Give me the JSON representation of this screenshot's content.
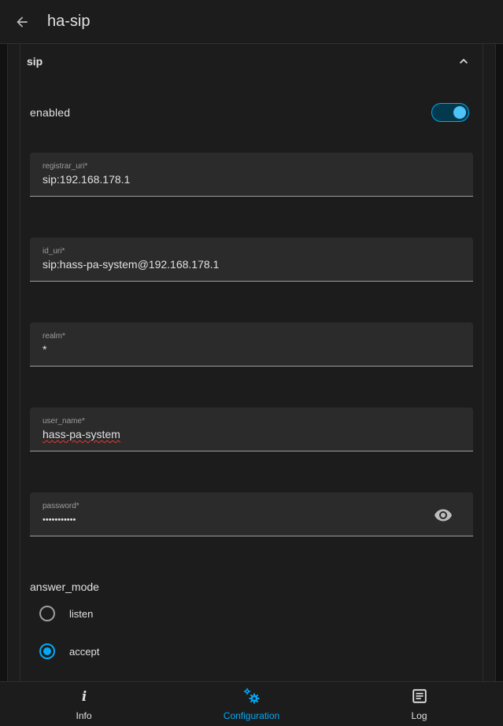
{
  "header": {
    "title": "ha-sip"
  },
  "section": {
    "title": "sip"
  },
  "enabled": {
    "label": "enabled",
    "value": true
  },
  "fields": [
    {
      "label": "registrar_uri*",
      "value": "sip:192.168.178.1"
    },
    {
      "label": "id_uri*",
      "value": "sip:hass-pa-system@192.168.178.1"
    },
    {
      "label": "realm*",
      "value": "*"
    },
    {
      "label": "user_name*",
      "value": "hass-pa-system"
    },
    {
      "label": "password*",
      "value": "•••••••••••"
    }
  ],
  "answer_mode": {
    "label": "answer_mode",
    "options": [
      {
        "label": "listen",
        "checked": false
      },
      {
        "label": "accept",
        "checked": true
      }
    ]
  },
  "nav": {
    "items": [
      {
        "label": "Info",
        "icon": "info-icon",
        "active": false
      },
      {
        "label": "Configuration",
        "icon": "cogs-icon",
        "active": true
      },
      {
        "label": "Log",
        "icon": "log-icon",
        "active": false
      }
    ]
  },
  "colors": {
    "accent": "#03a9f4",
    "background": "#111111",
    "surface": "#1c1c1c"
  }
}
